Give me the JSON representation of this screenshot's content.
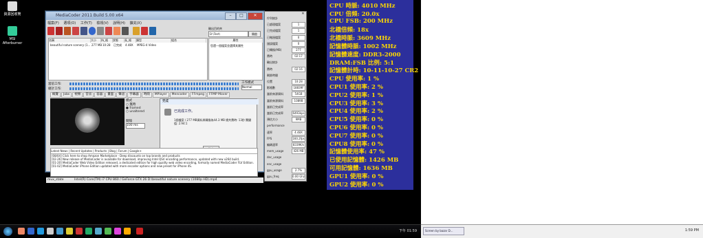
{
  "desktop": {
    "icons": [
      {
        "label": "資源回收筒",
        "icon": "recycle-bin-icon"
      },
      {
        "label": "MSI Afterburner",
        "icon": "afterburner-icon"
      }
    ]
  },
  "app": {
    "title": "MediaCoder 2011 Build 5.00 x64",
    "menu": [
      "檔案(F)",
      "選項(O)",
      "工作(T)",
      "檢視(V)",
      "說明(H)",
      "擴充(X)"
    ],
    "output_dir": {
      "label": "輸出目的夾",
      "value": "D:\\Test\\",
      "button": "開啟"
    },
    "file_columns": [
      "名稱",
      "大小",
      "持_格",
      "狀態",
      "長_格",
      "類型",
      "組合"
    ],
    "file_row": [
      "beautiful nature scenery (1...",
      "277 MB",
      "10:28",
      "已完成",
      "4.48X",
      "MPEG-4 Video"
    ],
    "property_header": "屬性",
    "property_value": "您還一個檔案並選擇其屬性",
    "progress": {
      "current_label": "當前工作:",
      "total_label": "總計工作:",
      "mode_label": "工作模式",
      "mode_value": "Normal",
      "current": 1.0,
      "total": 1.0
    },
    "tabs": [
      "概覽",
      "Jobs",
      "視頻",
      "音訊",
      "容器",
      "畫面",
      "聲道",
      "字幕器",
      "時間",
      "MPlayer",
      "Mencoder",
      "FFmpeg",
      "FFMP Mover"
    ],
    "options": {
      "title": "模式",
      "items": [
        "無時",
        "framed",
        "unaltered"
      ],
      "label2": "間隔",
      "interval": "100 ms"
    },
    "dialog": {
      "title": "完成",
      "heading": "已完成工作。",
      "message": "1個檔案 / 277 MB資料與轉換為44.3 MB 總共費時: 13秒 關鍵值: 2.94:1",
      "ok": "確定"
    },
    "news_tabs": [
      "Latest News",
      "Recent Updates",
      "Products",
      "Blog",
      "Forum",
      "Google+"
    ],
    "news": [
      "[08/04] Click here to shop Amazon Marketplace - Deep discounts on top brands and products",
      "[02-26] New release of MediaCoder is available for download, improving Intel QSV encoding performance, updated with new x264 build.",
      "[01-20] MediaCoder Web Video Edition released, a dedicated edition for high quality web video encoding, formally named MediaCoder FLV Edition.",
      "[01-02] MediaCoder iPhone Edition updated with more encoder options and new preset for iPhone 4S."
    ],
    "status": [
      "mux_state",
      "Intel(R) Core(TM) i7 CPU 860 / GeForce GTX 26 D:\\beautiful nature scenery (1080p HD).mp4"
    ]
  },
  "stats": {
    "rows": [
      [
        "佇列統計",
        ""
      ],
      [
        "已處理檔案",
        "1"
      ],
      [
        "已完成檔案",
        "1"
      ],
      [
        "已略過檔案",
        "0"
      ],
      [
        "錯誤檔案",
        "0"
      ],
      [
        "已轉換(MB)",
        "277"
      ],
      [
        "費時",
        "02:17"
      ],
      [
        "輸出統計",
        ""
      ],
      [
        "費時",
        "02:16"
      ],
      [
        "剩餘時間",
        ""
      ],
      [
        "位置",
        "10:28"
      ],
      [
        "影格數",
        "18839F"
      ],
      [
        "當前來源資料",
        "54GB"
      ],
      [
        "當前來源資料",
        "1089B"
      ],
      [
        "當前已完成率",
        ""
      ],
      [
        "當前已完成率",
        "6493kps"
      ],
      [
        "預估大小",
        "9MB"
      ],
      [
        "performance",
        ""
      ],
      [
        "速率",
        "4.48X"
      ],
      [
        "FPS",
        "160.2fps"
      ],
      [
        "編碼速率",
        "8339K/s"
      ],
      [
        "mem_usage",
        "426 MB"
      ],
      [
        "dec_usage",
        ""
      ],
      [
        "enc_usage",
        ""
      ],
      [
        "gpu_usage",
        "2.7%"
      ],
      [
        "gpu_freq",
        "0.00 Ghz"
      ]
    ]
  },
  "osd": {
    "lines": [
      "CPU 時脈: 4010 MHz",
      "CPU 倍頻: 20.0x",
      "CPU FSB: 200 MHz",
      "北橋倍頻: 18x",
      "北橋時脈: 3609 MHz",
      "記憶體時脈: 1002 MHz",
      "記憶體速度: DDR3-2000",
      "DRAM:FSB 比例: 5:1",
      "記憶體計時: 10-11-10-27 CR2",
      "CPU 使用率: 1 %",
      "CPU1 使用率: 2 %",
      "CPU2 使用率: 1 %",
      "CPU3 使用率: 3 %",
      "CPU4 使用率: 2 %",
      "CPU5 使用率: 0 %",
      "CPU6 使用率: 0 %",
      "CPU7 使用率: 0 %",
      "CPU8 使用率: 0 %",
      "記憶體使用率: 47 %",
      "已使用記憶體: 1426 MB",
      "可用記憶體: 1636 MB",
      "GPU1 使用率: 0 %",
      "GPU2 使用率: 0 %"
    ]
  },
  "taskbar": {
    "clock": "下午 01:59",
    "secondary_task": "Screen by bazar D...",
    "secondary_clock": "1:59 PM"
  }
}
